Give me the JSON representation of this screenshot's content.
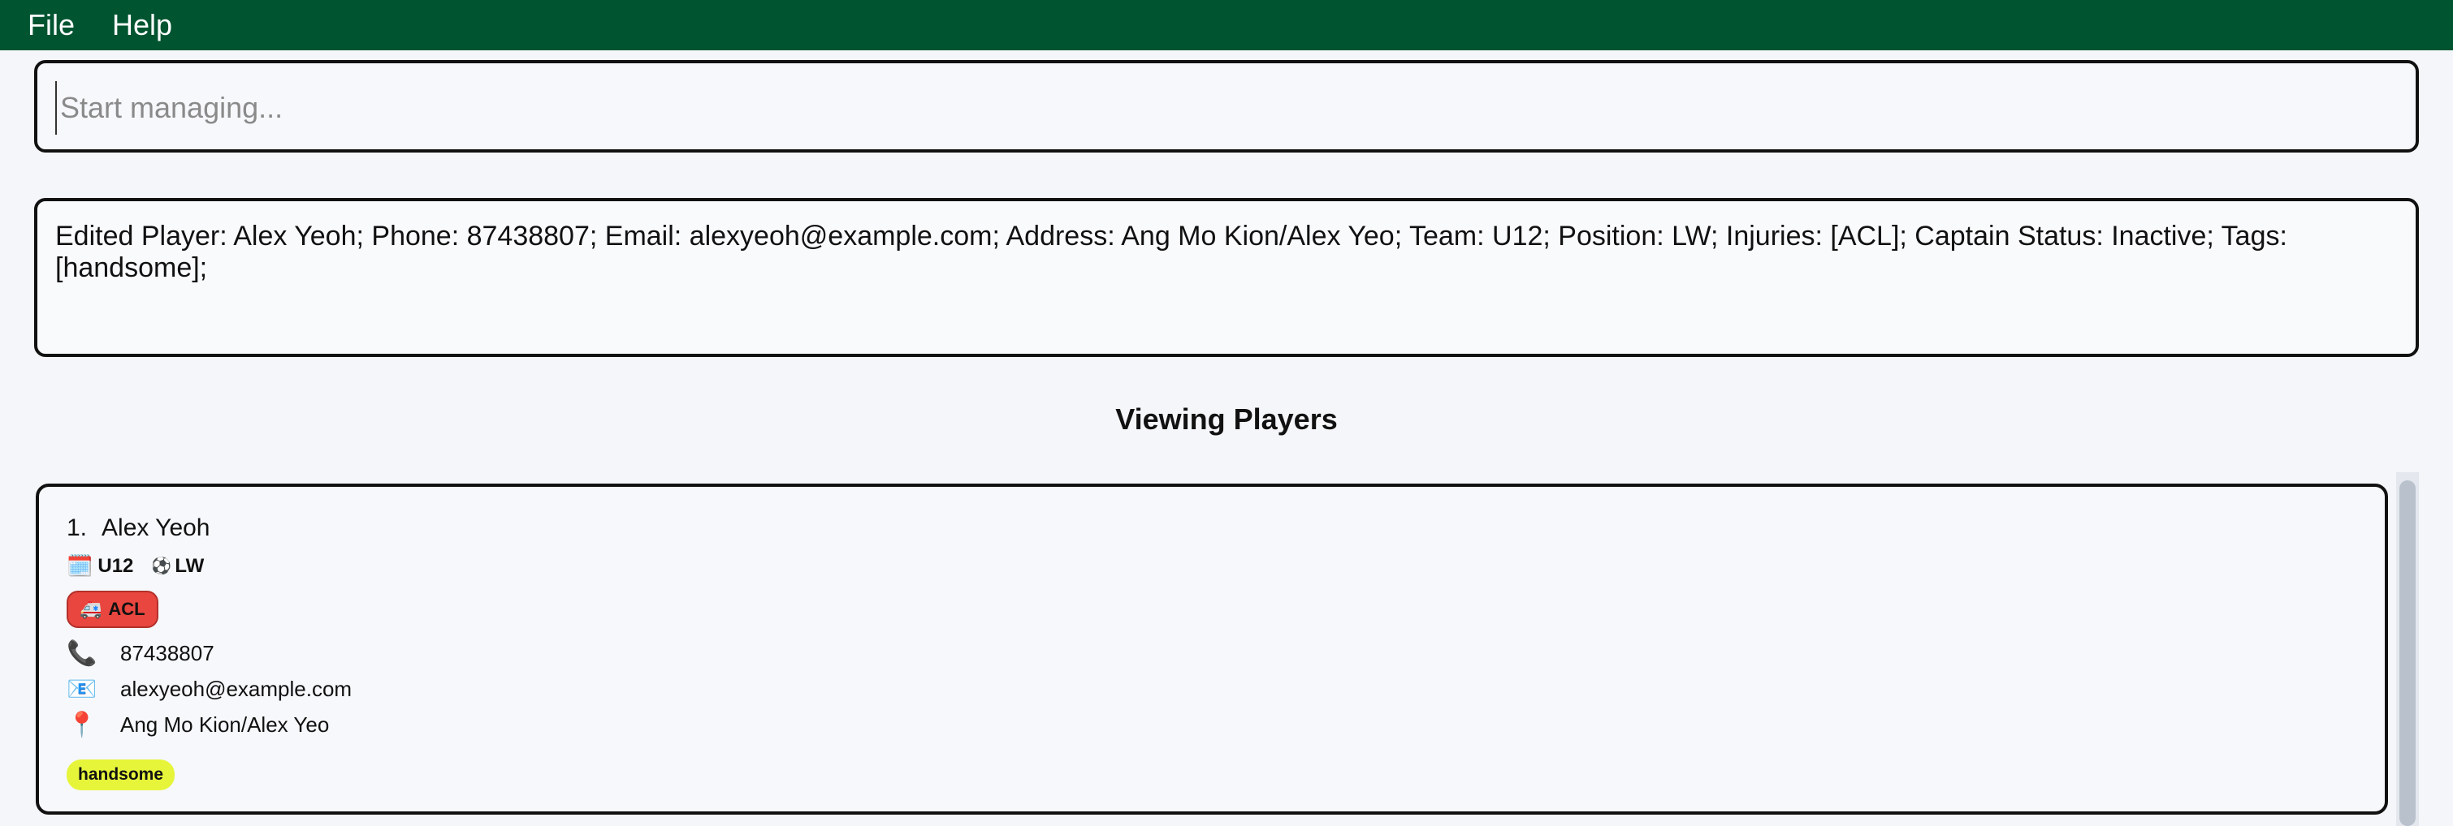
{
  "menu": {
    "file": "File",
    "help": "Help"
  },
  "command": {
    "placeholder": "Start managing...",
    "value": ""
  },
  "result": {
    "message": "Edited Player: Alex Yeoh; Phone: 87438807; Email: alexyeoh@example.com; Address: Ang Mo Kion/Alex Yeo; Team: U12; Position: LW; Injuries: [ACL]; Captain Status: Inactive; Tags: [handsome];"
  },
  "list": {
    "title": "Viewing Players",
    "players": [
      {
        "index": "1.",
        "name": "Alex Yeoh",
        "team": "U12",
        "position": "LW",
        "injury": "ACL",
        "phone": "87438807",
        "email": "alexyeoh@example.com",
        "address": "Ang Mo Kion/Alex Yeo",
        "tag": "handsome"
      }
    ]
  },
  "icons": {
    "team": "calendar-icon",
    "position": "soccer-ball-icon",
    "injury": "ambulance-icon",
    "phone": "phone-icon",
    "email": "envelope-icon",
    "address": "pin-icon"
  },
  "colors": {
    "menubar": "#005430",
    "injury_badge": "#e8463f",
    "tag_badge": "#e6f53a"
  }
}
